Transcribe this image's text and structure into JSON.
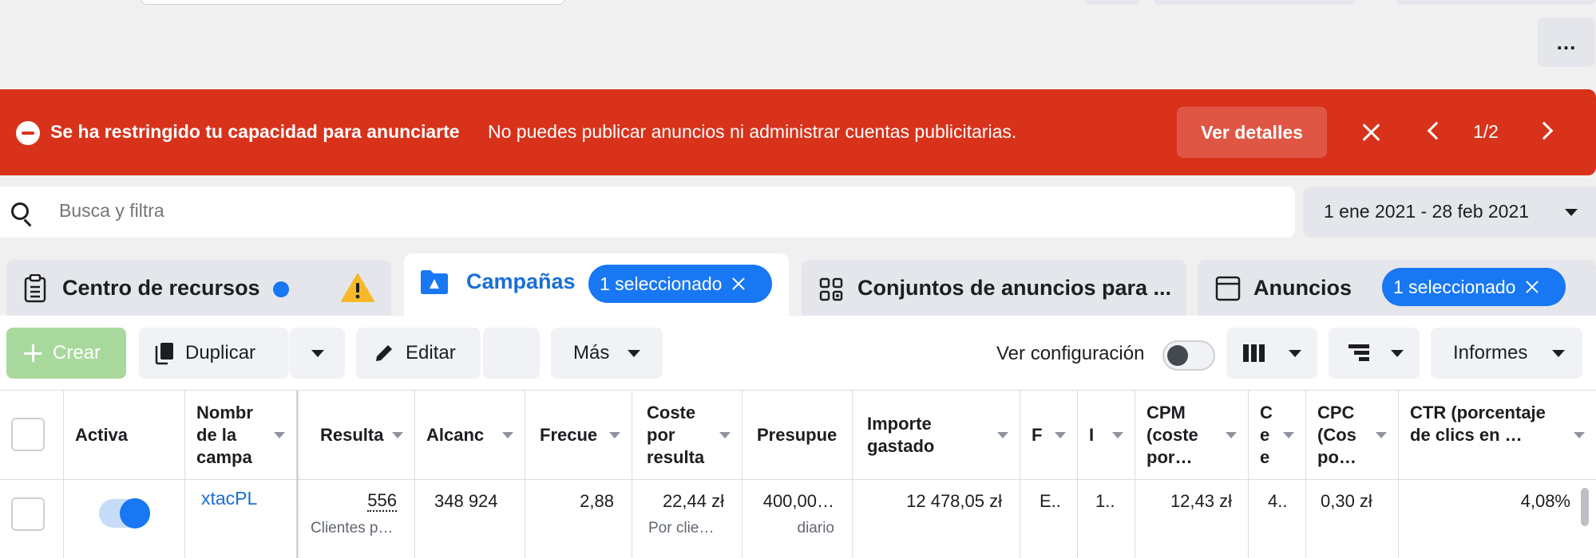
{
  "top": {
    "more_label": "..."
  },
  "alert": {
    "title": "Se ha restringido tu capacidad para anunciarte",
    "message": "No puedes publicar anuncios ni administrar cuentas publicitarias.",
    "details_button": "Ver detalles",
    "pager": "1/2",
    "color": "#d8321b"
  },
  "search": {
    "placeholder": "Busca y filtra"
  },
  "date_range": "1 ene 2021 - 28 feb 2021",
  "tabs": [
    {
      "label": "Centro de recursos",
      "icon": "clipboard-icon"
    },
    {
      "label": "Campañas",
      "badge": "1 seleccionado",
      "icon": "folder-icon"
    },
    {
      "label": "Conjuntos de anuncios para ...",
      "icon": "grid-icon"
    },
    {
      "label": "Anuncios",
      "badge": "1 seleccionado",
      "icon": "ad-icon"
    }
  ],
  "toolbar": {
    "create": "Crear",
    "duplicate": "Duplicar",
    "edit": "Editar",
    "more": "Más",
    "view_settings": "Ver configuración",
    "reports": "Informes"
  },
  "table": {
    "headers": [
      "Activa",
      "Nombr de la campa",
      "Resulta",
      "Alcanc",
      "Frecue",
      "Coste por resulta",
      "Presupue",
      "Importe gastado",
      "F",
      "I",
      "CPM (coste por…",
      "C e e",
      "CPC (Cos po…",
      "CTR (porcentaje de clics en …"
    ],
    "row": {
      "name": "xtacPL",
      "results": "556",
      "results_sub": "Clientes p…",
      "reach": "348 924",
      "frequency": "2,88",
      "cost_per_result": "22,44 zł",
      "cost_per_result_sub": "Por clie…",
      "budget": "400,00…",
      "budget_sub": "diario",
      "amount_spent": "12 478,05 zł",
      "col_f": "E..",
      "col_i": "1..",
      "cpm": "12,43 zł",
      "col_c": "4..",
      "cpc": "0,30 zł",
      "ctr": "4,08%"
    }
  }
}
